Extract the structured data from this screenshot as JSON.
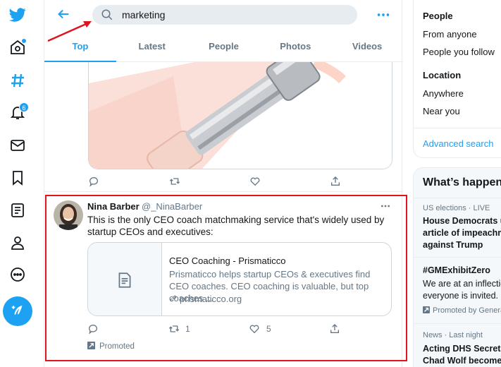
{
  "search": {
    "value": "marketing"
  },
  "tabs": [
    {
      "label": "Top",
      "active": true
    },
    {
      "label": "Latest",
      "active": false
    },
    {
      "label": "People",
      "active": false
    },
    {
      "label": "Photos",
      "active": false
    },
    {
      "label": "Videos",
      "active": false
    }
  ],
  "nav": {
    "icons": [
      "twitter-bird-icon",
      "home-icon",
      "explore-hash-icon",
      "notifications-bell-icon",
      "messages-icon",
      "bookmarks-icon",
      "lists-icon",
      "profile-icon",
      "more-icon",
      "compose-tweet-icon"
    ],
    "notification_count": "6"
  },
  "prev_tweet": {
    "media_icon": "dumbbell-image"
  },
  "tweet": {
    "name": "Nina Barber",
    "handle": "@_NinaBarber",
    "text": "This is the only CEO coach matchmaking service that's widely used by startup CEOs and executives:",
    "card": {
      "title": "CEO Coaching - Prismaticco",
      "description": "Prismaticco helps startup CEOs & executives find CEO coaches. CEO coaching is valuable, but top coaches ...",
      "url": "prismaticco.org"
    },
    "retweets": "1",
    "likes": "5",
    "promoted_label": "Promoted"
  },
  "filters": {
    "people_heading": "People",
    "people_options": [
      "From anyone",
      "People you follow"
    ],
    "location_heading": "Location",
    "location_options": [
      "Anywhere",
      "Near you"
    ],
    "advanced_label": "Advanced search"
  },
  "trends": {
    "heading": "What’s happening",
    "items": [
      {
        "meta": "US elections · LIVE",
        "title_lines": [
          "House Democrats u",
          "article of impeachm",
          "against Trump"
        ]
      },
      {
        "meta": "",
        "title_lines": [
          "#GMExhibitZero"
        ],
        "body_lines": [
          "We are at an inflectio",
          "everyone is invited."
        ],
        "promoted": "Promoted by Genera"
      },
      {
        "meta": "News · Last night",
        "title_lines": [
          "Acting DHS Secreta",
          "Chad Wolf become"
        ]
      }
    ]
  },
  "colors": {
    "accent": "#1da1f2",
    "highlight_border": "#e0141e"
  }
}
